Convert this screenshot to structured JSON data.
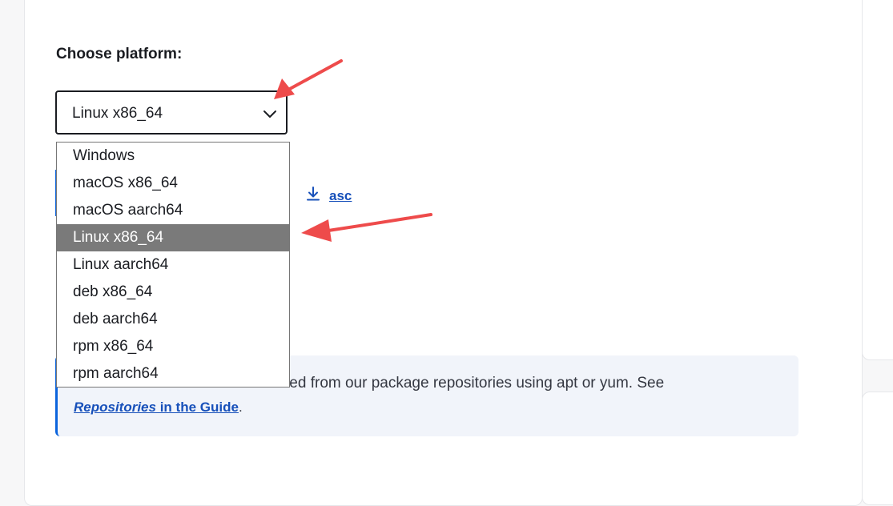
{
  "form": {
    "heading": "Choose platform:",
    "selected": "Linux x86_64",
    "options": [
      "Windows",
      "macOS x86_64",
      "macOS aarch64",
      "Linux x86_64",
      "Linux aarch64",
      "deb x86_64",
      "deb aarch64",
      "rpm x86_64",
      "rpm aarch64"
    ]
  },
  "download": {
    "asc_label": "asc"
  },
  "callout": {
    "text_visible": "Elasticsearch can also be installed from our package repositories using apt or yum. See",
    "link_em": "Repositories",
    "link_rest": " in the Guide",
    "period": "."
  },
  "colors": {
    "accent": "#0b64dd",
    "link": "#1750ba",
    "selected_option_bg": "#7a7a7a",
    "annotation_arrow": "#ee4b4b"
  },
  "icons": {
    "chevron": "chevron-down-icon",
    "download": "download-icon",
    "arrow": "annotation-arrow-icon"
  }
}
